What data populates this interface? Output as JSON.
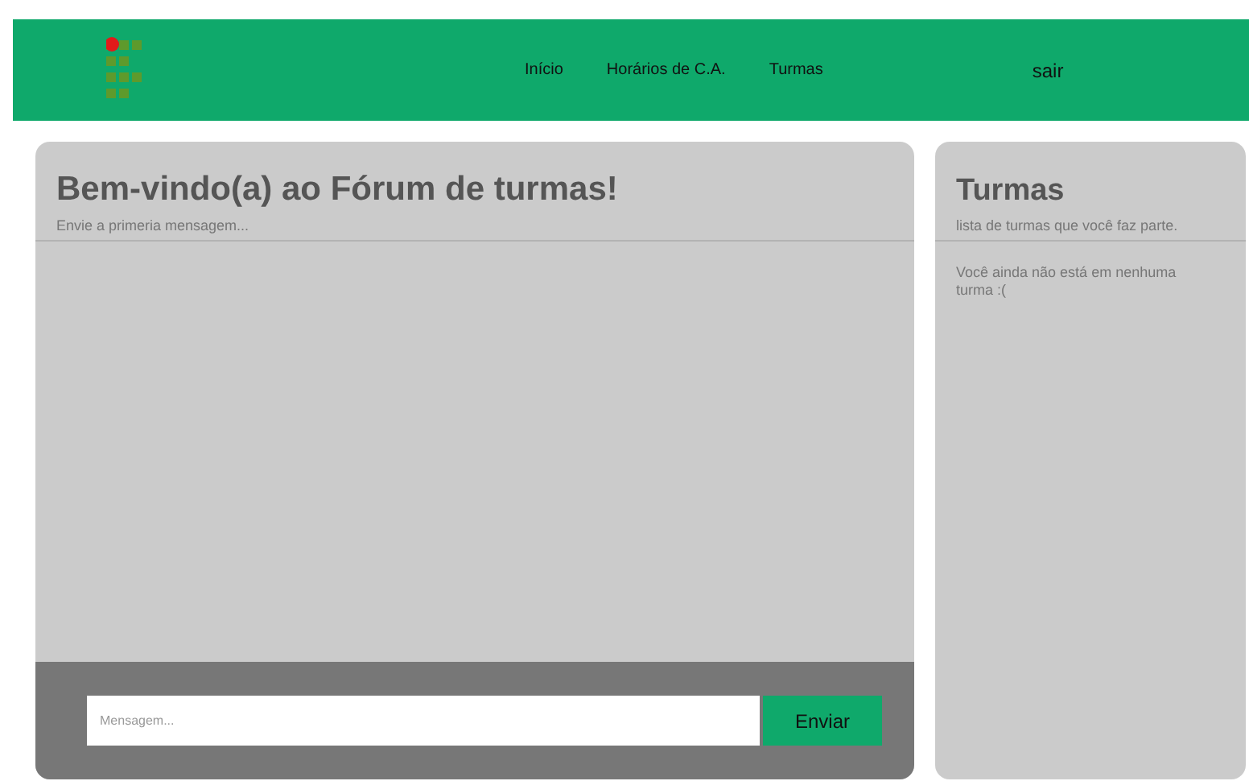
{
  "nav": {
    "links": [
      {
        "label": "Início"
      },
      {
        "label": "Horários de C.A."
      },
      {
        "label": "Turmas"
      }
    ],
    "logout": "sair"
  },
  "forum": {
    "title": "Bem-vindo(a) ao Fórum de turmas!",
    "subtitle": "Envie a primeria mensagem...",
    "message_field": {
      "placeholder": "Mensagem..."
    },
    "send_button": "Enviar"
  },
  "classes": {
    "title": "Turmas",
    "subtitle": "lista de turmas que você faz parte.",
    "empty_text": "Você ainda não está em nenhuma turma :("
  }
}
